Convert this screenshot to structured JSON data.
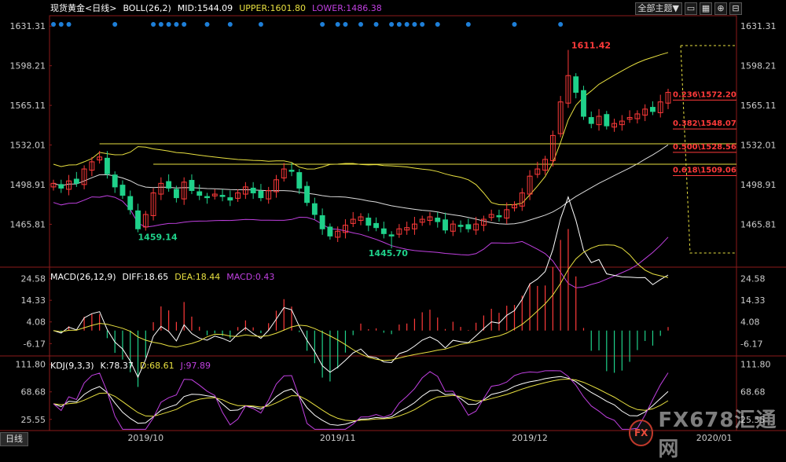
{
  "header": {
    "symbol": "现货黄金<日线>",
    "boll": "BOLL(26,2)",
    "mid": "MID:1544.09",
    "upper": "UPPER:1601.80",
    "lower": "LOWER:1486.38",
    "menu_label": "全部主题▼"
  },
  "macd_header": {
    "name": "MACD(26,12,9)",
    "diff": "DIFF:18.65",
    "dea": "DEA:18.44",
    "macd": "MACD:0.43"
  },
  "kdj_header": {
    "name": "KDJ(9,3,3)",
    "k": "K:78.37",
    "d": "D:68.61",
    "j": "J:97.89"
  },
  "tab_label": "日线",
  "logo": {
    "mark": "FX",
    "text": "FX678汇通网"
  },
  "colors": {
    "up": "#ff3a3a",
    "down": "#1fd18a",
    "boll": "#e8e040",
    "mid": "#dcdcdc",
    "lower": "#c040e0",
    "diff": "#ffffff",
    "dea": "#e8e040",
    "j": "#c040e0",
    "fib": "#e8e040",
    "dots": "#1e7fd8"
  },
  "chart_data": {
    "type": "candlestick",
    "price_axis": {
      "ticks": [
        "1631.31",
        "1598.21",
        "1565.11",
        "1532.01",
        "1498.91",
        "1465.81"
      ],
      "range": [
        1430,
        1640
      ]
    },
    "macd_axis": {
      "ticks": [
        "24.58",
        "14.33",
        "4.08",
        "-6.17"
      ],
      "range": [
        -12,
        30
      ]
    },
    "kdj_axis": {
      "ticks": [
        "111.80",
        "68.68",
        "25.55"
      ],
      "range": [
        8,
        125
      ]
    },
    "x_labels": [
      "2019/10",
      "2019/11",
      "2019/12",
      "2020/01"
    ],
    "annotations": [
      {
        "label": "1611.42",
        "x": 67,
        "value": 1611.42,
        "color": "#ff3a3a"
      },
      {
        "label": "1459.14",
        "x": 11,
        "value": 1459.14,
        "color": "#1fd18a"
      },
      {
        "label": "1445.70",
        "x": 41,
        "value": 1445.7,
        "color": "#1fd18a"
      }
    ],
    "fib_levels": [
      {
        "label": "0.236\\1572.20",
        "value": 1572.2
      },
      {
        "label": "0.382\\1548.07",
        "value": 1548.07
      },
      {
        "label": "0.500\\1528.56",
        "value": 1528.56
      },
      {
        "label": "0.618\\1509.06",
        "value": 1509.06
      }
    ],
    "support_lines": [
      {
        "from": 6,
        "value": 1533
      },
      {
        "from": 13,
        "value": 1516
      }
    ]
  }
}
